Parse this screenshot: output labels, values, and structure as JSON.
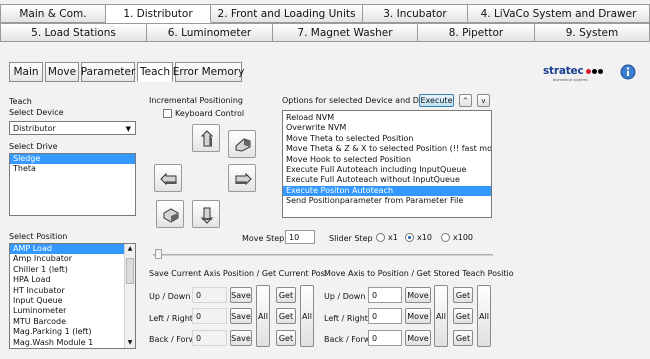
{
  "main_tabs_row1": [
    "Main & Com.",
    "1. Distributor",
    "2. Front and Loading Units",
    "3. Incubator",
    "4. LiVaCo System and Drawer"
  ],
  "main_tabs_row2": [
    "5. Load Stations",
    "6. Luminometer",
    "7. Magnet Washer",
    "8. Pipettor",
    "9. System"
  ],
  "sub_tabs": [
    "Main",
    "Move",
    "Parameter",
    "Teach",
    "Error Memory"
  ],
  "brand": "stratec",
  "brand_sub": "biomedical systems",
  "info_icon": "info-icon",
  "teach": {
    "section": "Teach",
    "select_device_label": "Select Device",
    "device_value": "Distributor",
    "select_drive_label": "Select Drive",
    "drives": [
      "Sledge",
      "Theta"
    ],
    "select_position_label": "Select Position",
    "positions": [
      "AMP Load",
      "Amp Incubator",
      "Chiller 1 (left)",
      "HPA Load",
      "HT Incubator",
      "Input Queue",
      "Luminometer",
      "MTU Barcode",
      "Mag.Parking 1 (left)",
      "Mag.Wash Module 1"
    ]
  },
  "incremental": {
    "section": "Incremental Positioning",
    "keyboard_control": "Keyboard Control"
  },
  "options": {
    "section": "Options for selected Device and Drive",
    "execute": "Execute",
    "up": "^",
    "down": "v",
    "items": [
      "Reload NVM",
      "Overwrite NVM",
      "Move Theta to selected Position",
      "Move Theta & Z & X to selected Position (!! fast move !!)",
      "Move Hook to selected Position",
      "Execute Full Autoteach including InputQueue",
      "Execute Full Autoteach without InputQueue",
      "Execute Positon Autoteach",
      "Send Positionparameter from Parameter File"
    ]
  },
  "step": {
    "move_step_label": "Move Step",
    "move_step_value": "10",
    "slider_step_label": "Slider Step",
    "radios": [
      "x1",
      "x10",
      "x100"
    ],
    "selected_radio": "x10"
  },
  "save_section": {
    "title": "Save Current Axis Position / Get Current Pos.",
    "rows": [
      {
        "label": "Up / Down",
        "value": "0"
      },
      {
        "label": "Left / Right",
        "value": "0"
      },
      {
        "label": "Back / Forw.",
        "value": "0"
      }
    ],
    "save": "Save",
    "get": "Get",
    "all": "All"
  },
  "move_section": {
    "title": "Move Axis to Position / Get Stored Teach Positio",
    "rows": [
      {
        "label": "Up / Down",
        "value": "0"
      },
      {
        "label": "Left / Right",
        "value": "0"
      },
      {
        "label": "Back / Forw.",
        "value": "0"
      }
    ],
    "move": "Move",
    "get": "Get",
    "all": "All"
  }
}
